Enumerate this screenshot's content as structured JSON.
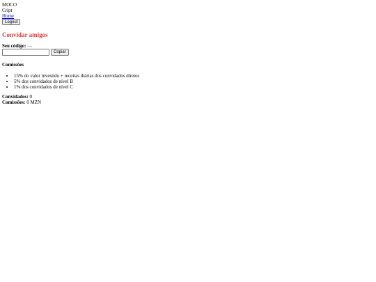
{
  "brand": {
    "line1": "MOCO",
    "line2": "Cript"
  },
  "nav": {
    "home_label": "Home",
    "logout_label": "Logout"
  },
  "invite": {
    "title": "Convidar amigos",
    "code_label": "Seu código:",
    "code_value": "—",
    "code_input_value": "",
    "copy_label": "Copiar"
  },
  "commissions": {
    "heading": "Comissões",
    "rules": [
      "15% do valor investido + receitas diárias dos convidados diretos",
      "5% dos convidados de nível B",
      "1% dos convidados de nível C"
    ]
  },
  "stats": {
    "invited_label": "Convidados:",
    "invited_value": "0",
    "commission_label": "Comissões:",
    "commission_value": "0 MZN"
  }
}
